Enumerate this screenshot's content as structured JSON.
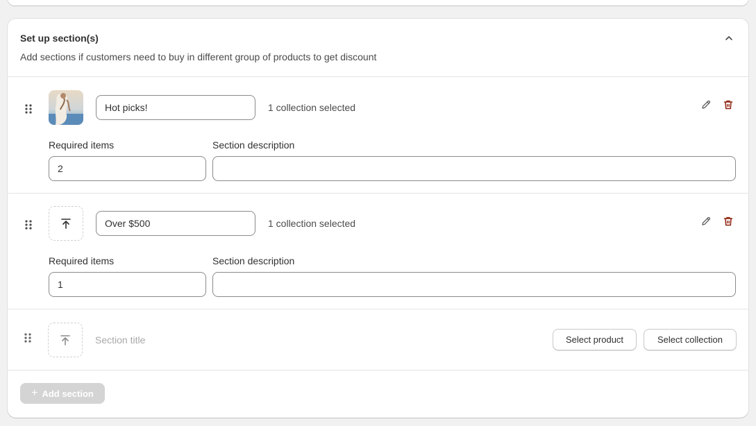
{
  "card": {
    "title": "Set up section(s)",
    "subtitle": "Add sections if customers need to buy in different group of products to get discount"
  },
  "sections": [
    {
      "title_value": "Hot picks!",
      "collection_text": "1 collection selected",
      "required_items_label": "Required items",
      "required_items_value": "2",
      "description_label": "Section description",
      "description_value": "",
      "image": "product-photo"
    },
    {
      "title_value": "Over $500",
      "collection_text": "1 collection selected",
      "required_items_label": "Required items",
      "required_items_value": "1",
      "description_label": "Section description",
      "description_value": "",
      "image": "upload-icon"
    }
  ],
  "new_section": {
    "title_placeholder": "Section title",
    "select_product_label": "Select product",
    "select_collection_label": "Select collection"
  },
  "add_section_label": "Add section",
  "colors": {
    "delete": "#8e1f0b",
    "disabled_button": "#d4d4d4",
    "border": "#8a8a8a"
  }
}
